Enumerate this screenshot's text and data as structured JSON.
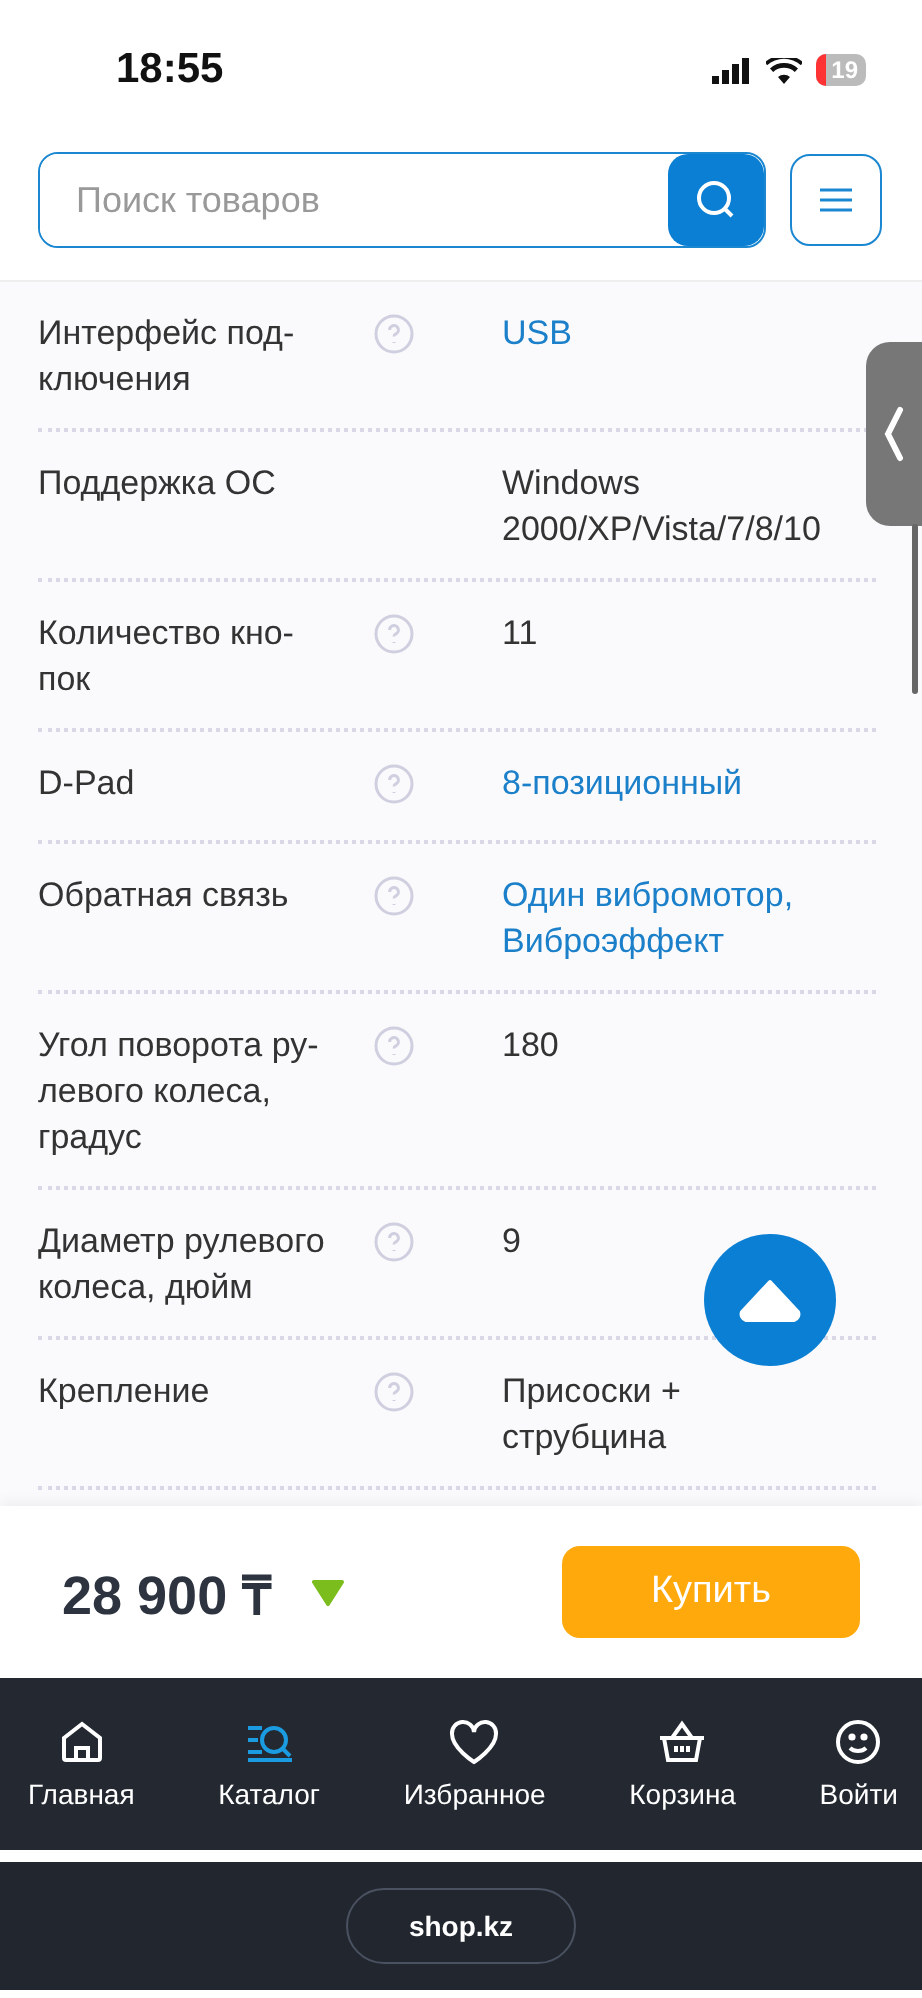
{
  "status_bar": {
    "time": "18:55",
    "battery": "19"
  },
  "search": {
    "placeholder": "Поиск товаров"
  },
  "specs": [
    {
      "label": "Интерфейс под-\nключения",
      "value": "USB",
      "link": true,
      "help": true
    },
    {
      "label": "Поддержка ОС",
      "value": "Windows 2000/XP/Vista/7/8/10",
      "link": false,
      "help": false
    },
    {
      "label": "Количество кно-\nпок",
      "value": "11",
      "link": false,
      "help": true
    },
    {
      "label": "D-Pad",
      "value": "8-позиционный",
      "link": true,
      "help": true
    },
    {
      "label": "Обратная связь",
      "value": "Один вибромотор, Виброэффект",
      "link": true,
      "help": true
    },
    {
      "label": "Угол поворота ру-\nлевого колеса,\nградус",
      "value": "180",
      "link": false,
      "help": true
    },
    {
      "label": "Диаметр рулевого\nколеса, дюйм",
      "value": "9",
      "link": false,
      "help": true
    },
    {
      "label": "Крепление",
      "value": "Присоски + струбцина",
      "link": false,
      "help": true
    }
  ],
  "price": {
    "amount": "28 900 ₸"
  },
  "buy_button": "Купить",
  "nav": [
    {
      "label": "Главная",
      "kind": "home",
      "selected": false
    },
    {
      "label": "Каталог",
      "kind": "catalog",
      "selected": true
    },
    {
      "label": "Избранное",
      "kind": "heart",
      "selected": false
    },
    {
      "label": "Корзина",
      "kind": "basket",
      "selected": false
    },
    {
      "label": "Войти",
      "kind": "smile",
      "selected": false
    }
  ],
  "browser": {
    "url": "shop.kz"
  }
}
